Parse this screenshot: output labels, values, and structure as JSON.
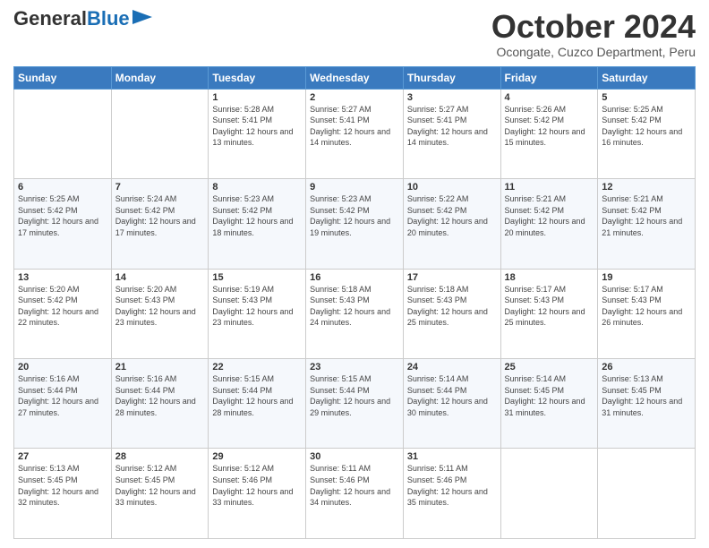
{
  "header": {
    "logo_general": "General",
    "logo_blue": "Blue",
    "month_title": "October 2024",
    "subtitle": "Ocongate, Cuzco Department, Peru"
  },
  "days_of_week": [
    "Sunday",
    "Monday",
    "Tuesday",
    "Wednesday",
    "Thursday",
    "Friday",
    "Saturday"
  ],
  "weeks": [
    [
      {
        "day": "",
        "sunrise": "",
        "sunset": "",
        "daylight": ""
      },
      {
        "day": "",
        "sunrise": "",
        "sunset": "",
        "daylight": ""
      },
      {
        "day": "1",
        "sunrise": "Sunrise: 5:28 AM",
        "sunset": "Sunset: 5:41 PM",
        "daylight": "Daylight: 12 hours and 13 minutes."
      },
      {
        "day": "2",
        "sunrise": "Sunrise: 5:27 AM",
        "sunset": "Sunset: 5:41 PM",
        "daylight": "Daylight: 12 hours and 14 minutes."
      },
      {
        "day": "3",
        "sunrise": "Sunrise: 5:27 AM",
        "sunset": "Sunset: 5:41 PM",
        "daylight": "Daylight: 12 hours and 14 minutes."
      },
      {
        "day": "4",
        "sunrise": "Sunrise: 5:26 AM",
        "sunset": "Sunset: 5:42 PM",
        "daylight": "Daylight: 12 hours and 15 minutes."
      },
      {
        "day": "5",
        "sunrise": "Sunrise: 5:25 AM",
        "sunset": "Sunset: 5:42 PM",
        "daylight": "Daylight: 12 hours and 16 minutes."
      }
    ],
    [
      {
        "day": "6",
        "sunrise": "Sunrise: 5:25 AM",
        "sunset": "Sunset: 5:42 PM",
        "daylight": "Daylight: 12 hours and 17 minutes."
      },
      {
        "day": "7",
        "sunrise": "Sunrise: 5:24 AM",
        "sunset": "Sunset: 5:42 PM",
        "daylight": "Daylight: 12 hours and 17 minutes."
      },
      {
        "day": "8",
        "sunrise": "Sunrise: 5:23 AM",
        "sunset": "Sunset: 5:42 PM",
        "daylight": "Daylight: 12 hours and 18 minutes."
      },
      {
        "day": "9",
        "sunrise": "Sunrise: 5:23 AM",
        "sunset": "Sunset: 5:42 PM",
        "daylight": "Daylight: 12 hours and 19 minutes."
      },
      {
        "day": "10",
        "sunrise": "Sunrise: 5:22 AM",
        "sunset": "Sunset: 5:42 PM",
        "daylight": "Daylight: 12 hours and 20 minutes."
      },
      {
        "day": "11",
        "sunrise": "Sunrise: 5:21 AM",
        "sunset": "Sunset: 5:42 PM",
        "daylight": "Daylight: 12 hours and 20 minutes."
      },
      {
        "day": "12",
        "sunrise": "Sunrise: 5:21 AM",
        "sunset": "Sunset: 5:42 PM",
        "daylight": "Daylight: 12 hours and 21 minutes."
      }
    ],
    [
      {
        "day": "13",
        "sunrise": "Sunrise: 5:20 AM",
        "sunset": "Sunset: 5:42 PM",
        "daylight": "Daylight: 12 hours and 22 minutes."
      },
      {
        "day": "14",
        "sunrise": "Sunrise: 5:20 AM",
        "sunset": "Sunset: 5:43 PM",
        "daylight": "Daylight: 12 hours and 23 minutes."
      },
      {
        "day": "15",
        "sunrise": "Sunrise: 5:19 AM",
        "sunset": "Sunset: 5:43 PM",
        "daylight": "Daylight: 12 hours and 23 minutes."
      },
      {
        "day": "16",
        "sunrise": "Sunrise: 5:18 AM",
        "sunset": "Sunset: 5:43 PM",
        "daylight": "Daylight: 12 hours and 24 minutes."
      },
      {
        "day": "17",
        "sunrise": "Sunrise: 5:18 AM",
        "sunset": "Sunset: 5:43 PM",
        "daylight": "Daylight: 12 hours and 25 minutes."
      },
      {
        "day": "18",
        "sunrise": "Sunrise: 5:17 AM",
        "sunset": "Sunset: 5:43 PM",
        "daylight": "Daylight: 12 hours and 25 minutes."
      },
      {
        "day": "19",
        "sunrise": "Sunrise: 5:17 AM",
        "sunset": "Sunset: 5:43 PM",
        "daylight": "Daylight: 12 hours and 26 minutes."
      }
    ],
    [
      {
        "day": "20",
        "sunrise": "Sunrise: 5:16 AM",
        "sunset": "Sunset: 5:44 PM",
        "daylight": "Daylight: 12 hours and 27 minutes."
      },
      {
        "day": "21",
        "sunrise": "Sunrise: 5:16 AM",
        "sunset": "Sunset: 5:44 PM",
        "daylight": "Daylight: 12 hours and 28 minutes."
      },
      {
        "day": "22",
        "sunrise": "Sunrise: 5:15 AM",
        "sunset": "Sunset: 5:44 PM",
        "daylight": "Daylight: 12 hours and 28 minutes."
      },
      {
        "day": "23",
        "sunrise": "Sunrise: 5:15 AM",
        "sunset": "Sunset: 5:44 PM",
        "daylight": "Daylight: 12 hours and 29 minutes."
      },
      {
        "day": "24",
        "sunrise": "Sunrise: 5:14 AM",
        "sunset": "Sunset: 5:44 PM",
        "daylight": "Daylight: 12 hours and 30 minutes."
      },
      {
        "day": "25",
        "sunrise": "Sunrise: 5:14 AM",
        "sunset": "Sunset: 5:45 PM",
        "daylight": "Daylight: 12 hours and 31 minutes."
      },
      {
        "day": "26",
        "sunrise": "Sunrise: 5:13 AM",
        "sunset": "Sunset: 5:45 PM",
        "daylight": "Daylight: 12 hours and 31 minutes."
      }
    ],
    [
      {
        "day": "27",
        "sunrise": "Sunrise: 5:13 AM",
        "sunset": "Sunset: 5:45 PM",
        "daylight": "Daylight: 12 hours and 32 minutes."
      },
      {
        "day": "28",
        "sunrise": "Sunrise: 5:12 AM",
        "sunset": "Sunset: 5:45 PM",
        "daylight": "Daylight: 12 hours and 33 minutes."
      },
      {
        "day": "29",
        "sunrise": "Sunrise: 5:12 AM",
        "sunset": "Sunset: 5:46 PM",
        "daylight": "Daylight: 12 hours and 33 minutes."
      },
      {
        "day": "30",
        "sunrise": "Sunrise: 5:11 AM",
        "sunset": "Sunset: 5:46 PM",
        "daylight": "Daylight: 12 hours and 34 minutes."
      },
      {
        "day": "31",
        "sunrise": "Sunrise: 5:11 AM",
        "sunset": "Sunset: 5:46 PM",
        "daylight": "Daylight: 12 hours and 35 minutes."
      },
      {
        "day": "",
        "sunrise": "",
        "sunset": "",
        "daylight": ""
      },
      {
        "day": "",
        "sunrise": "",
        "sunset": "",
        "daylight": ""
      }
    ]
  ]
}
